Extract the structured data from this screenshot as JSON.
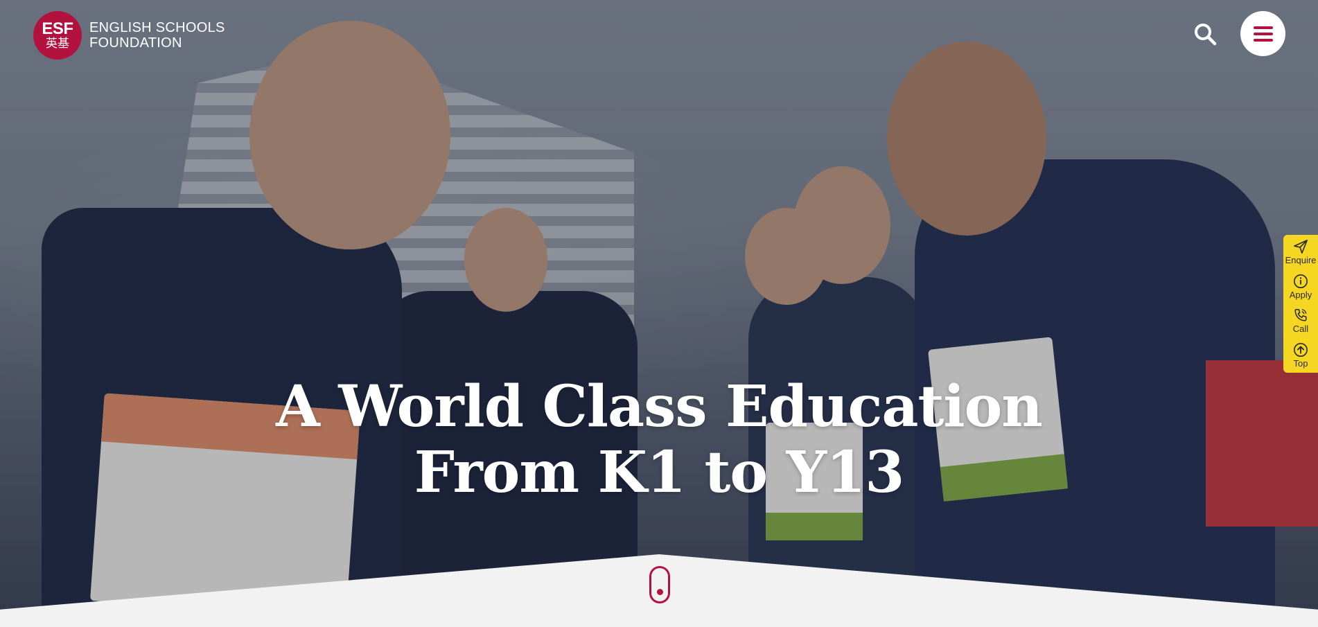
{
  "header": {
    "logo_mark": "ESF",
    "logo_chinese": "英基",
    "logo_line1": "ENGLISH SCHOOLS",
    "logo_line2": "FOUNDATION",
    "search_icon": "search-icon",
    "menu_icon": "hamburger-menu-icon"
  },
  "hero": {
    "title_line1": "A World Class Education",
    "title_line2": "From K1 to Y13"
  },
  "side_actions": [
    {
      "label": "Enquire",
      "icon": "send-icon"
    },
    {
      "label": "Apply",
      "icon": "info-icon"
    },
    {
      "label": "Call",
      "icon": "phone-icon"
    },
    {
      "label": "Top",
      "icon": "arrow-up-icon"
    }
  ],
  "colors": {
    "brand": "#b3123f",
    "side_tab": "#f4d623",
    "page_bg": "#f3f2f2"
  }
}
